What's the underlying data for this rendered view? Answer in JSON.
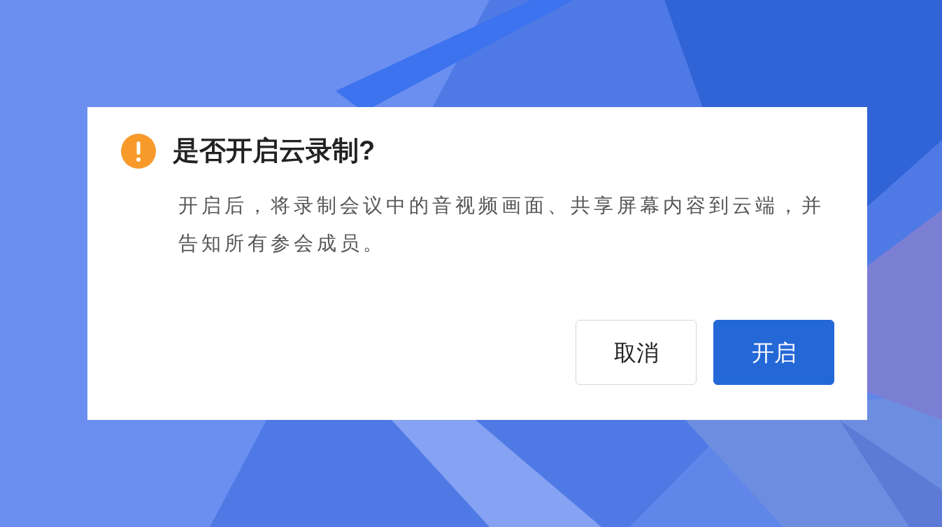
{
  "dialog": {
    "title": "是否开启云录制?",
    "message": "开启后，将录制会议中的音视频画面、共享屏幕内容到云端，并告知所有参会成员。",
    "buttons": [
      {
        "label": "取消",
        "kind": "secondary"
      },
      {
        "label": "开启",
        "kind": "primary"
      }
    ]
  }
}
